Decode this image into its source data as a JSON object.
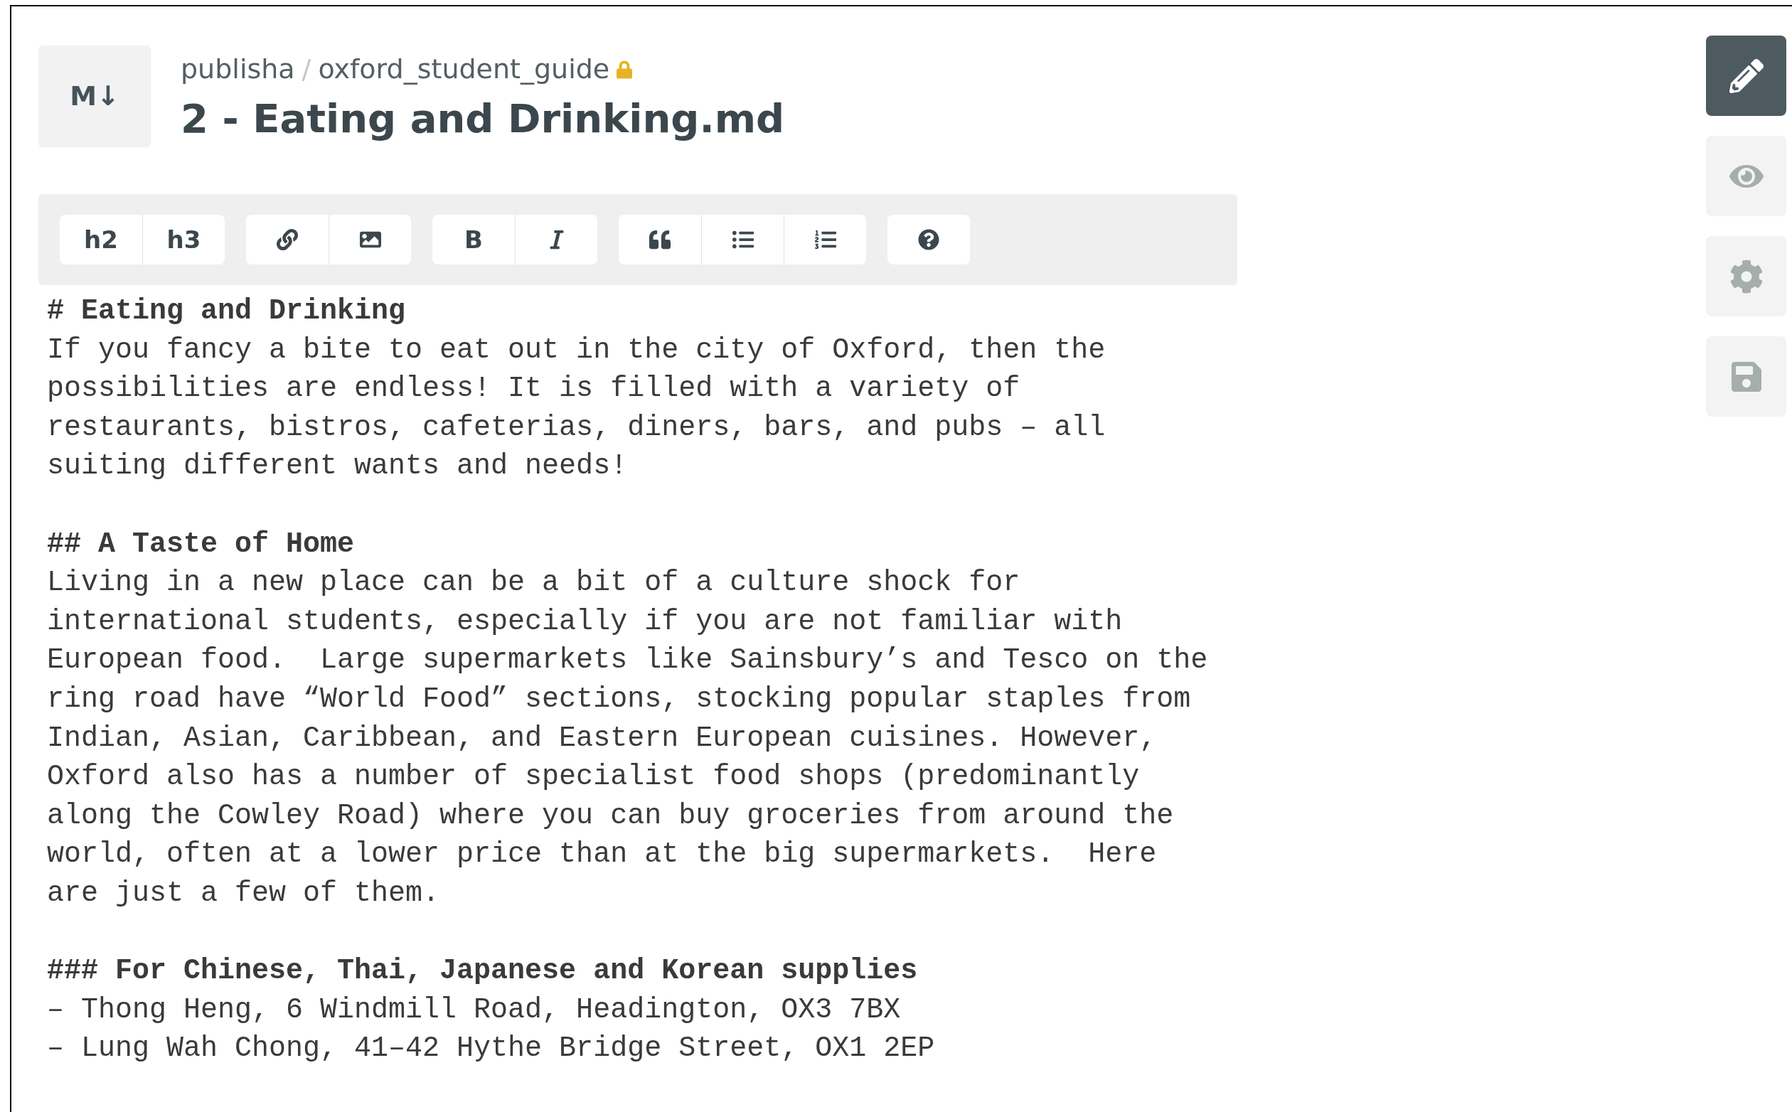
{
  "header": {
    "logo": "M↓",
    "owner": "publisha",
    "separator": "/",
    "repo": "oxford_student_guide",
    "locked": true,
    "title": "2 - Eating and Drinking.md"
  },
  "toolbar": {
    "groups": [
      {
        "buttons": [
          {
            "kind": "text",
            "label": "h2"
          },
          {
            "kind": "text",
            "label": "h3"
          }
        ]
      },
      {
        "buttons": [
          {
            "kind": "link"
          },
          {
            "kind": "image"
          }
        ]
      },
      {
        "buttons": [
          {
            "kind": "bold",
            "label": "B"
          },
          {
            "kind": "italic"
          }
        ]
      },
      {
        "buttons": [
          {
            "kind": "quote"
          },
          {
            "kind": "bullets"
          },
          {
            "kind": "numbers"
          }
        ]
      },
      {
        "buttons": [
          {
            "kind": "help"
          }
        ]
      }
    ]
  },
  "editor": {
    "blocks": [
      {
        "heading": "# Eating and Drinking",
        "lines": [
          "If you fancy a bite to eat out in the city of Oxford, then the",
          "possibilities are endless! It is filled with a variety of",
          "restaurants, bistros, cafeterias, diners, bars, and pubs – all",
          "suiting different wants and needs!"
        ]
      },
      {
        "heading": "## A Taste of Home",
        "lines": [
          "Living in a new place can be a bit of a culture shock for",
          "international students, especially if you are not familiar with",
          "European food.  Large supermarkets like Sainsbury’s and Tesco on the",
          "ring road have “World Food” sections, stocking popular staples from",
          "Indian, Asian, Caribbean, and Eastern European cuisines. However,",
          "Oxford also has a number of specialist food shops (predominantly",
          "along the Cowley Road) where you can buy groceries from around the",
          "world, often at a lower price than at the big supermarkets.  Here",
          "are just a few of them."
        ]
      },
      {
        "heading": "### For Chinese, Thai, Japanese and Korean supplies",
        "lines": [
          "– Thong Heng, 6 Windmill Road, Headington, OX3 7BX",
          "– Lung Wah Chong, 41–42 Hythe Bridge Street, OX1 2EP"
        ]
      }
    ]
  },
  "sidebar": {
    "items": [
      {
        "kind": "edit",
        "selected": true
      },
      {
        "kind": "preview",
        "selected": false
      },
      {
        "kind": "settings",
        "selected": false
      },
      {
        "kind": "save",
        "selected": false
      }
    ]
  }
}
